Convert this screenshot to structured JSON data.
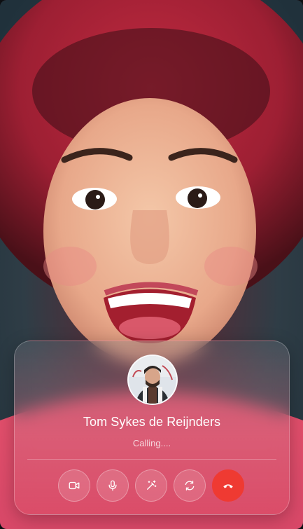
{
  "call": {
    "caller_name": "Tom Sykes de Reijnders",
    "status": "Calling....",
    "avatar": "caller-avatar-photo"
  },
  "controls": [
    {
      "name": "video-toggle-button",
      "icon": "video-camera-icon"
    },
    {
      "name": "mute-button",
      "icon": "microphone-icon"
    },
    {
      "name": "effects-button",
      "icon": "magic-wand-icon"
    },
    {
      "name": "switch-camera-button",
      "icon": "rotate-camera-icon"
    },
    {
      "name": "end-call-button",
      "icon": "hang-up-icon"
    }
  ],
  "colors": {
    "end_call": "#ef3a32",
    "card_tint": "#dc5069"
  }
}
